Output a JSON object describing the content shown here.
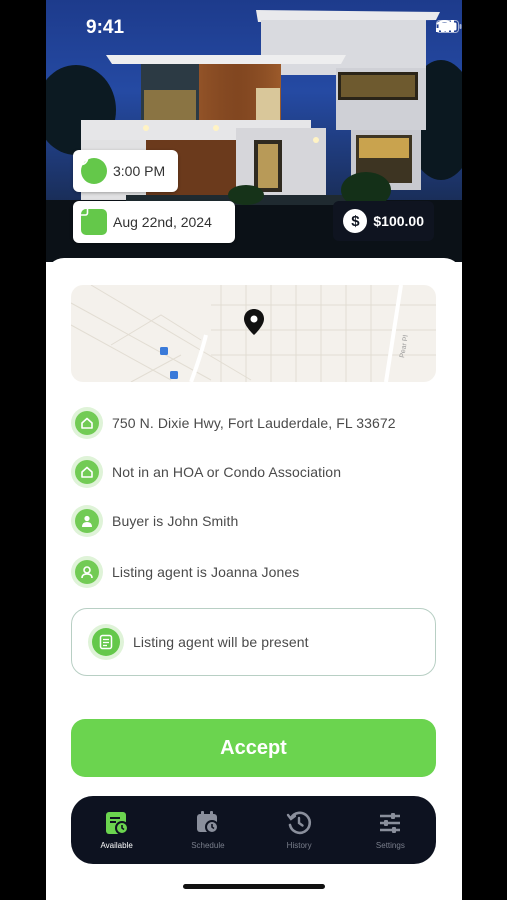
{
  "status_bar": {
    "time": "9:41"
  },
  "hero": {
    "time_label": "3:00 PM",
    "date_label": "Aug 22nd, 2024",
    "price_label": "$100.00"
  },
  "map": {
    "street_label": "Pear Pl"
  },
  "details": [
    {
      "icon": "house-icon",
      "text": "750 N. Dixie Hwy, Fort Lauderdale, FL 33672"
    },
    {
      "icon": "house-icon",
      "text": "Not in an HOA or Condo Association"
    },
    {
      "icon": "person-icon",
      "text": "Buyer is John Smith"
    },
    {
      "icon": "agent-icon",
      "text": "Listing agent is Joanna Jones"
    }
  ],
  "present_note": {
    "icon": "checklist-icon",
    "text": "Listing agent will be present"
  },
  "accept_label": "Accept",
  "tabs": [
    {
      "label": "Available",
      "icon": "available-icon",
      "active": true
    },
    {
      "label": "Schedule",
      "icon": "calendar-clock-icon",
      "active": false
    },
    {
      "label": "History",
      "icon": "history-icon",
      "active": false
    },
    {
      "label": "Settings",
      "icon": "sliders-icon",
      "active": false
    }
  ],
  "colors": {
    "accent": "#6bd44f",
    "accent_dark": "#64c84a",
    "tabbar": "#0d1220",
    "text": "#4a4a4a"
  }
}
